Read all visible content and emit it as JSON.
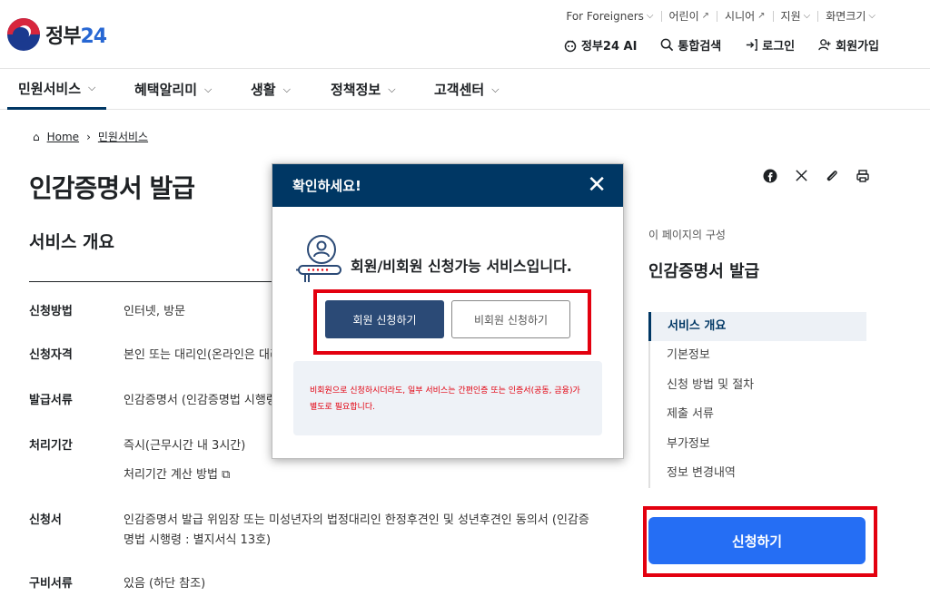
{
  "header": {
    "logo_text": "정부",
    "logo_num": "24",
    "util": [
      {
        "label": "For Foreigners",
        "icon": "chevron-down-icon"
      },
      {
        "label": "어린이",
        "icon": "external-link-icon"
      },
      {
        "label": "시니어",
        "icon": "external-link-icon"
      },
      {
        "label": "지원",
        "icon": "chevron-down-icon"
      },
      {
        "label": "화면크기",
        "icon": "chevron-down-icon"
      }
    ],
    "quick": [
      {
        "label": "정부24 AI",
        "icon": "ai-bot-icon"
      },
      {
        "label": "통합검색",
        "icon": "search-icon"
      },
      {
        "label": "로그인",
        "icon": "login-icon"
      },
      {
        "label": "회원가입",
        "icon": "user-plus-icon"
      }
    ]
  },
  "gnb": [
    {
      "label": "민원서비스"
    },
    {
      "label": "혜택알리미"
    },
    {
      "label": "생활"
    },
    {
      "label": "정책정보"
    },
    {
      "label": "고객센터"
    }
  ],
  "breadcrumb": {
    "home": "Home",
    "current": "민원서비스"
  },
  "main": {
    "title": "인감증명서 발급",
    "section_title": "서비스 개요",
    "rows": [
      {
        "key": "신청방법",
        "value": "인터넷, 방문"
      },
      {
        "key": "신청자격",
        "value": "본인 또는 대리인(온라인은 대리"
      },
      {
        "key": "발급서류",
        "value": "인감증명서 (인감증명법 시행령"
      },
      {
        "key": "처리기간",
        "value": "즉시(근무시간 내 3시간)",
        "extra": "처리기간 계산 방법"
      },
      {
        "key": "신청서",
        "value": "인감증명서 발급 위임장 또는 미성년자의 법정대리인 한정후견인 및 성년후견인 동의서 (인감증명법 시행령 : 별지서식 13호)"
      },
      {
        "key": "구비서류",
        "value": "있음 (하단 참조)"
      }
    ]
  },
  "toc": {
    "label": "이 페이지의 구성",
    "title": "인감증명서 발급",
    "items": [
      "서비스 개요",
      "기본정보",
      "신청 방법 및 절차",
      "제출 서류",
      "부가정보",
      "정보 변경내역"
    ],
    "active_index": 0
  },
  "apply_button": "신청하기",
  "modal": {
    "title": "확인하세요!",
    "message": "회원/비회원 신청가능 서비스입니다.",
    "member_button": "회원 신청하기",
    "guest_button": "비회원 신청하기",
    "note": "비회원으로 신청하시더라도, 일부 서비스는 간편인증 또는 인증서(공동, 금융)가 별도로 필요합니다."
  },
  "colors": {
    "primary_navy": "#003764",
    "apply_blue": "#256ef4",
    "highlight_red": "#e3000f",
    "note_red": "#e3000f"
  }
}
